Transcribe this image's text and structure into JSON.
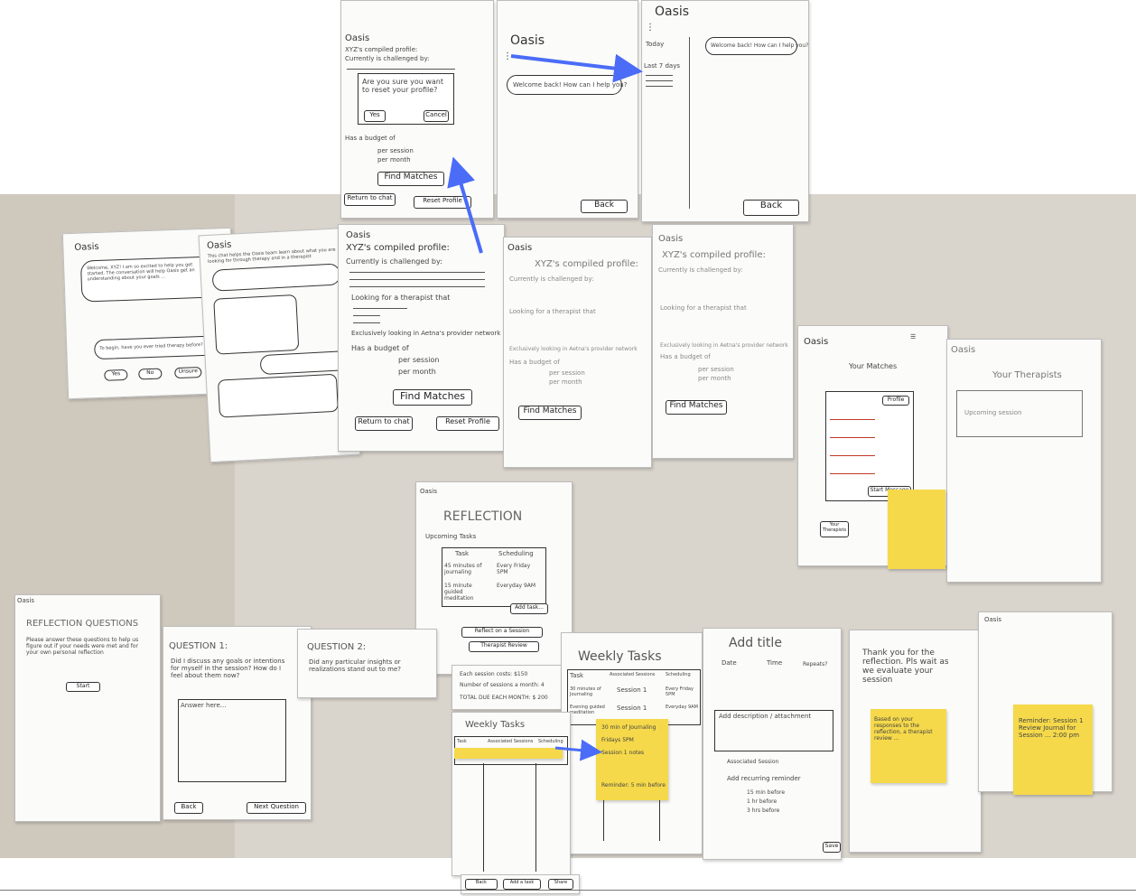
{
  "colors": {
    "table": "#d9d4cc",
    "paper": "#fbfbf9",
    "arrow": "#4a6cf7",
    "sticky": "#f5d94a"
  },
  "top_row": {
    "s1": {
      "brand": "Oasis",
      "profile_title": "XYZ's compiled profile:",
      "challenged": "Currently is challenged by:",
      "dialog_text": "Are you sure you want to reset your profile?",
      "yes": "Yes",
      "cancel": "Cancel",
      "budget": "Has a budget of",
      "per_session": "per session",
      "per_month": "per month",
      "find": "Find Matches",
      "return": "Return to chat",
      "reset": "Reset Profile"
    },
    "s2": {
      "brand": "Oasis",
      "welcome": "Welcome back! How can I help you?",
      "back": "Back"
    },
    "s3": {
      "brand": "Oasis",
      "today": "Today",
      "last7": "Last 7 days",
      "welcome": "Welcome back! How can I help you?",
      "back": "Back"
    }
  },
  "chat1": {
    "brand": "Oasis",
    "greeting": "Welcome, XYZ! I am so excited to help you get started. The conversation will help Oasis get an understanding about your goals ...",
    "question": "To begin, have you ever tried therapy before?",
    "opt1": "Yes",
    "opt2": "No",
    "opt3": "Unsure"
  },
  "chat2": {
    "brand": "Oasis",
    "intro": "This chat helps the Oasis team learn about what you are looking for through therapy and in a therapist"
  },
  "profile_main": {
    "brand": "Oasis",
    "title": "XYZ's compiled profile:",
    "challenged": "Currently is challenged by:",
    "looking": "Looking for a therapist that",
    "exclusive": "Exclusively looking in Aetna's provider network",
    "budget": "Has a budget of",
    "per_session": "per session",
    "per_month": "per month",
    "find": "Find Matches",
    "return": "Return to chat",
    "reset": "Reset Profile"
  },
  "profile_b": {
    "brand": "Oasis",
    "title": "XYZ's compiled profile:",
    "challenged": "Currently is challenged by:",
    "looking": "Looking for a therapist that",
    "exclusive": "Exclusively looking in Aetna's provider network",
    "budget": "Has a budget of",
    "per_session": "per session",
    "per_month": "per month",
    "find": "Find Matches"
  },
  "profile_c": {
    "brand": "Oasis",
    "title": "XYZ's compiled profile:",
    "challenged": "Currently is challenged by:",
    "looking": "Looking for a therapist that",
    "exclusive": "Exclusively looking in Aetna's provider network",
    "budget": "Has a budget of",
    "per_session": "per session",
    "per_month": "per month",
    "find": "Find Matches"
  },
  "matches": {
    "brand": "Oasis",
    "title": "Your Matches",
    "profile_btn": "Profile",
    "message": "Start Message",
    "therapists": "Your Therapists"
  },
  "therapists": {
    "brand": "Oasis",
    "title": "Your Therapists",
    "upcoming": "Upcoming session"
  },
  "reflection": {
    "brand": "Oasis",
    "title": "REFLECTION",
    "upcoming": "Upcoming Tasks",
    "col_task": "Task",
    "col_sched": "Scheduling",
    "task1": "45 minutes of journaling",
    "sched1": "Every Friday 5PM",
    "task2": "15 minute guided meditation",
    "sched2": "Everyday 9AM",
    "add": "Add task...",
    "reflect": "Reflect on a Session",
    "review": "Therapist Review",
    "cost1": "Each session costs: $150",
    "cost2": "Number of sessions a month: 4",
    "cost3": "TOTAL DUE EACH MONTH: $ 200"
  },
  "rq": {
    "brand": "Oasis",
    "title": "REFLECTION QUESTIONS",
    "body": "Please answer these questions to help us figure out if your needs were met and for your own personal reflection",
    "start": "Start"
  },
  "q1": {
    "title": "QUESTION 1:",
    "body": "Did I discuss any goals or intentions for myself in the session? How do I feel about them now?",
    "placeholder": "Answer here...",
    "back": "Back",
    "next": "Next Question"
  },
  "q2": {
    "title": "QUESTION 2:",
    "body": "Did any particular insights or realizations stand out to me?"
  },
  "weekly_a": {
    "title": "Weekly Tasks",
    "col1": "Task",
    "col2": "Associated Sessions",
    "col3": "Scheduling",
    "r1c1": "30 minutes of Journaling",
    "r1c2": "Session 1",
    "r1c3": "Every Friday 5PM",
    "r2c1": "Evening guided meditation",
    "r2c2": "Session 1",
    "r2c3": "Everyday 9AM",
    "note1": "30 min of Journaling",
    "note2": "Fridays 5PM",
    "note3": "Session 1 notes",
    "reminder": "Reminder: 5 min before"
  },
  "weekly_b": {
    "title": "Weekly Tasks",
    "col1": "Task",
    "col2": "Associated Sessions",
    "col3": "Scheduling",
    "btn1": "Back",
    "btn2": "Add a task",
    "btn3": "Share"
  },
  "add_title": {
    "title": "Add title",
    "date": "Date",
    "time": "Time",
    "repeats": "Repeats?",
    "desc": "Add description / attachment",
    "assoc": "Associated Session",
    "reminder": "Add recurring reminder",
    "opt1": "15 min before",
    "opt2": "1 hr before",
    "opt3": "3 hrs before",
    "save": "Save"
  },
  "thanks": {
    "text": "Thank you for the reflection. Pls wait as we evaluate your session",
    "sticky": "Based on your responses to the reflection, a therapist review ..."
  },
  "reminder_sheet": {
    "brand": "Oasis",
    "sticky": "Reminder: Session 1 Review Journal for Session ... 2:00 pm"
  },
  "bottom_card": {
    "btn1": "Back",
    "btn2": "Add a task",
    "btn3": "Share"
  }
}
